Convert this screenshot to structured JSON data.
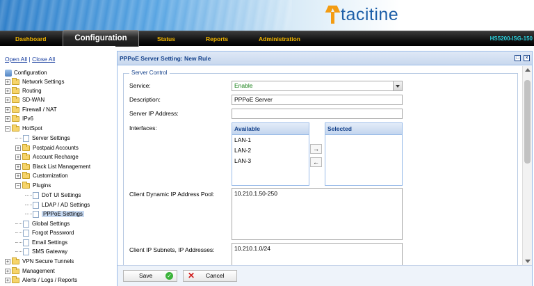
{
  "brand": {
    "logo_text": "tacitine"
  },
  "nav": {
    "items": [
      {
        "label": "Dashboard"
      },
      {
        "label": "Configuration"
      },
      {
        "label": "Status"
      },
      {
        "label": "Reports"
      },
      {
        "label": "Administration"
      }
    ],
    "active": "Configuration",
    "model": "HS5200-ISG-150"
  },
  "sidebar": {
    "open_all": "Open All",
    "separator": "|",
    "close_all": "Close All",
    "root": "Configuration",
    "items": [
      {
        "label": "Network Settings"
      },
      {
        "label": "Routing"
      },
      {
        "label": "SD-WAN"
      },
      {
        "label": "Firewall / NAT"
      },
      {
        "label": "IPv6"
      },
      {
        "label": "HotSpot"
      },
      {
        "label": "Server Settings"
      },
      {
        "label": "Postpaid Accounts"
      },
      {
        "label": "Account Recharge"
      },
      {
        "label": "Black List Management"
      },
      {
        "label": "Customization"
      },
      {
        "label": "Plugins"
      },
      {
        "label": "DoT UI Settings"
      },
      {
        "label": "LDAP / AD Settings"
      },
      {
        "label": "PPPoE Settings"
      },
      {
        "label": "Global Settings"
      },
      {
        "label": "Forgot Password"
      },
      {
        "label": "Email Settings"
      },
      {
        "label": "SMS Gateway"
      },
      {
        "label": "VPN Secure Tunnels"
      },
      {
        "label": "Management"
      },
      {
        "label": "Alerts / Logs / Reports"
      }
    ],
    "selected": "PPPoE Settings"
  },
  "panel": {
    "title": "PPPoE Server Setting: New Rule",
    "fieldset_legend": "Server Control",
    "service": {
      "label": "Service:",
      "value": "Enable"
    },
    "description": {
      "label": "Description:",
      "value": "PPPoE Server"
    },
    "server_ip": {
      "label": "Server IP Address:",
      "value": ""
    },
    "interfaces": {
      "label": "Interfaces:",
      "available_header": "Available",
      "selected_header": "Selected",
      "available": [
        "LAN-1",
        "LAN-2",
        "LAN-3"
      ],
      "selected": [],
      "move_right": "→",
      "move_left": "←"
    },
    "dynamic_pool": {
      "label": "Client Dynamic IP Address Pool:",
      "value": "10.210.1.50-250"
    },
    "subnets": {
      "label": "Client IP Subnets, IP Addresses:",
      "value": "10.210.1.0/24"
    }
  },
  "footer": {
    "save_label": "Save",
    "cancel_label": "Cancel"
  }
}
